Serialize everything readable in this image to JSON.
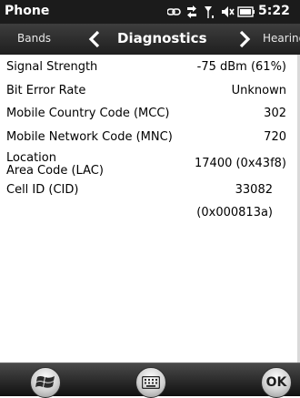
{
  "status_bar": {
    "app_title": "Phone",
    "clock": "5:22",
    "icons": [
      "link-icon",
      "data-activity-icon",
      "signal-icon",
      "volume-icon",
      "battery-icon"
    ]
  },
  "tab_bar": {
    "previous_tab": "Bands",
    "current_tab": "Diagnostics",
    "next_tab": "Hearing Aid"
  },
  "diagnostics": {
    "signal_strength": {
      "label": "Signal Strength",
      "value": "-75 dBm (61%)"
    },
    "bit_error_rate": {
      "label": "Bit Error Rate",
      "value": "Unknown"
    },
    "mcc": {
      "label": "Mobile Country Code (MCC)",
      "value": "302"
    },
    "mnc": {
      "label": "Mobile Network Code (MNC)",
      "value": "720"
    },
    "lac": {
      "label_line1": "Location",
      "label_line2": "Area Code (LAC)",
      "value": "17400 (0x43f8)"
    },
    "cell_id": {
      "label": "Cell ID (CID)",
      "value": "33082",
      "value_hex": "(0x000813a)"
    }
  },
  "bottom_bar": {
    "ok_label": "OK",
    "buttons": [
      "start-icon",
      "keyboard-icon",
      "ok-button"
    ]
  },
  "colors": {
    "status_bar_bg": "#1b1b1b",
    "tab_bar_bg": "#2e2e2e",
    "content_bg": "#ffffff",
    "text": "#000000"
  }
}
